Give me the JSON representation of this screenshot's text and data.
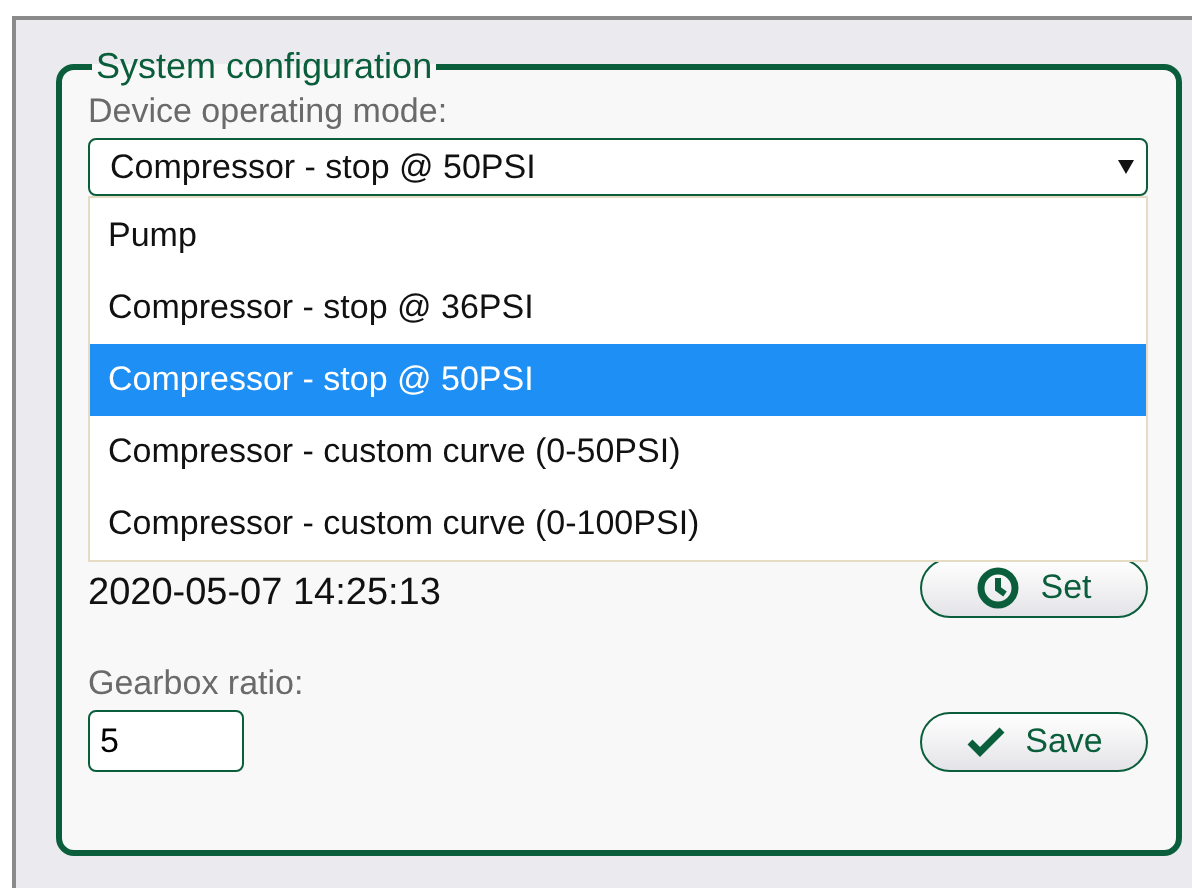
{
  "panel": {
    "legend": "System configuration"
  },
  "mode": {
    "label": "Device operating mode:",
    "value": "Compressor - stop @ 50PSI",
    "expanded": true,
    "options": [
      {
        "label": "Pump",
        "selected": false
      },
      {
        "label": "Compressor - stop @ 36PSI",
        "selected": false
      },
      {
        "label": "Compressor - stop @ 50PSI",
        "selected": true
      },
      {
        "label": "Compressor - custom curve (0-50PSI)",
        "selected": false
      },
      {
        "label": "Compressor - custom curve (0-100PSI)",
        "selected": false
      }
    ]
  },
  "clock": {
    "datetime": "2020-05-07 14:25:13",
    "button": "Set"
  },
  "gearbox": {
    "label": "Gearbox ratio:",
    "value": "5",
    "button": "Save"
  }
}
